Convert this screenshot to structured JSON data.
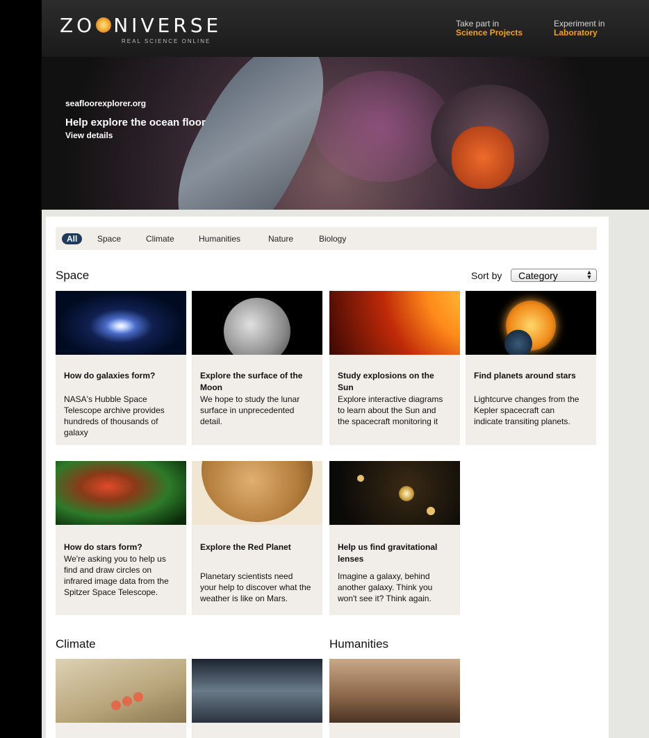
{
  "header": {
    "logo_left": "ZO",
    "logo_right": "NIVERSE",
    "tagline": "REAL SCIENCE ONLINE",
    "links": [
      {
        "pre": "Take part in",
        "label": "Science Projects"
      },
      {
        "pre": "Experiment in",
        "label": "Laboratory"
      }
    ]
  },
  "hero": {
    "url": "seafloorexplorer.org",
    "title": "Help explore the ocean floor",
    "link": "View details"
  },
  "filters": [
    "All",
    "Space",
    "Climate",
    "Humanities",
    "Nature",
    "Biology"
  ],
  "active_filter": "All",
  "sort": {
    "label": "Sort by",
    "value": "Category"
  },
  "sections": {
    "space": "Space",
    "climate": "Climate",
    "humanities": "Humanities"
  },
  "cards": [
    {
      "title": "How do galaxies form?",
      "desc": "NASA's Hubble Space Telescope archive provides hundreds of thousands of galaxy"
    },
    {
      "title": "Explore the surface of the Moon",
      "desc": "We hope to study the lunar surface in unprecedented detail."
    },
    {
      "title": "Study explosions on the Sun",
      "desc": "Explore interactive diagrams to learn about the Sun and the spacecraft monitoring it"
    },
    {
      "title": "Find planets around stars",
      "desc": "Lightcurve changes from the Kepler spacecraft can indicate transiting planets."
    },
    {
      "title": "How do stars form?",
      "desc": "We're asking you to help us find and draw circles on infrared image data from the Spitzer Space Telescope."
    },
    {
      "title": "Explore the Red Planet",
      "desc": "Planetary scientists need your help to discover what the weather is like on Mars."
    },
    {
      "title": "Help us find gravitational lenses",
      "desc": "Imagine a galaxy, behind another galaxy. Think you won't see it? Think again."
    }
  ],
  "colors": {
    "accent": "#f7a21b",
    "filter_active": "#1e3a5c",
    "card_bg": "#f1eee9"
  }
}
